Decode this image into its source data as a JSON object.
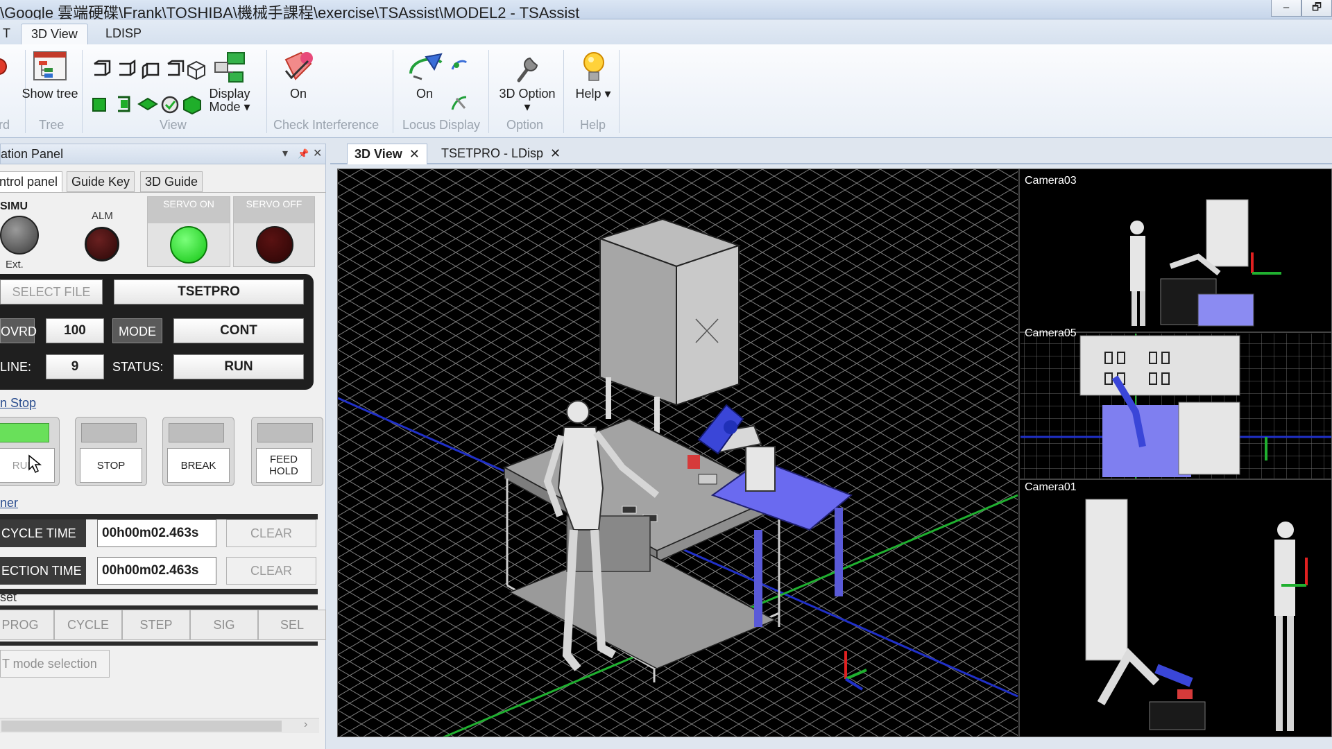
{
  "window": {
    "title": "\\Google 雲端硬碟\\Frank\\TOSHIBA\\機械手課程\\exercise\\TSAssist\\MODEL2   - TSAssist",
    "minimize": "–",
    "restore": "🗗"
  },
  "ribbon": {
    "tabs": [
      {
        "label": "T"
      },
      {
        "label": "3D View"
      },
      {
        "label": "LDISP"
      }
    ],
    "partial_group_label": "rd",
    "tree": {
      "label": "Show tree",
      "group": "Tree"
    },
    "view": {
      "group": "View",
      "display_mode": "Display Mode ▾"
    },
    "check_interference": {
      "label": "On",
      "group": "Check Interference"
    },
    "locus_display": {
      "label": "On",
      "group": "Locus Display"
    },
    "option": {
      "label": "3D Option ▾",
      "group": "Option"
    },
    "help": {
      "label": "Help ▾",
      "group": "Help"
    }
  },
  "panel": {
    "title": "ation Panel",
    "pin_controls": [
      "▾",
      "📌",
      "✕"
    ],
    "tabs": [
      {
        "label": "ntrol panel"
      },
      {
        "label": "Guide Key"
      },
      {
        "label": "3D Guide"
      }
    ],
    "simu": {
      "label": "SIMU",
      "sub": "Ext."
    },
    "alm": {
      "label": "ALM"
    },
    "servo_on": {
      "label": "SERVO ON"
    },
    "servo_off": {
      "label": "SERVO OFF"
    },
    "select_file": {
      "label": "SELECT FILE",
      "value": "TSETPRO"
    },
    "ovrd": {
      "label": "OVRD",
      "value": "100"
    },
    "mode": {
      "label": "MODE",
      "value": "CONT"
    },
    "line": {
      "label": "LINE:",
      "value": "9"
    },
    "status": {
      "label": "STATUS:",
      "value": "RUN"
    },
    "runstop": {
      "title": "n Stop",
      "buttons": [
        {
          "label": "RUN"
        },
        {
          "label": "STOP"
        },
        {
          "label": "BREAK"
        },
        {
          "label": "FEED HOLD"
        }
      ]
    },
    "timer": {
      "title": "ner",
      "rows": [
        {
          "label": "CYCLE TIME",
          "value": "00h00m02.463s",
          "clear": "CLEAR"
        },
        {
          "label": "ECTION TIME",
          "value": "00h00m02.463s",
          "clear": "CLEAR"
        }
      ]
    },
    "reset": {
      "title": "set",
      "buttons": [
        "PROG",
        "CYCLE",
        "STEP",
        "SIG",
        "SEL"
      ]
    },
    "mode_selection": "T mode selection",
    "scroll_arrow": "›"
  },
  "document_tabs": [
    {
      "label": "3D View",
      "close": "✕"
    },
    {
      "label": "TSETPRO - LDisp",
      "close": "✕"
    }
  ],
  "viewport": {
    "cameras": [
      "Camera03",
      "Camera05",
      "Camera01"
    ]
  },
  "colors": {
    "servo_on_lamp": "#1ee21e",
    "servo_off_lamp": "#4a0a0a",
    "alarm_lamp": "#3a0d0d",
    "run_led": "#69e05a",
    "robot_table": "#5f5fe0",
    "grid": "#8a8a8a"
  }
}
